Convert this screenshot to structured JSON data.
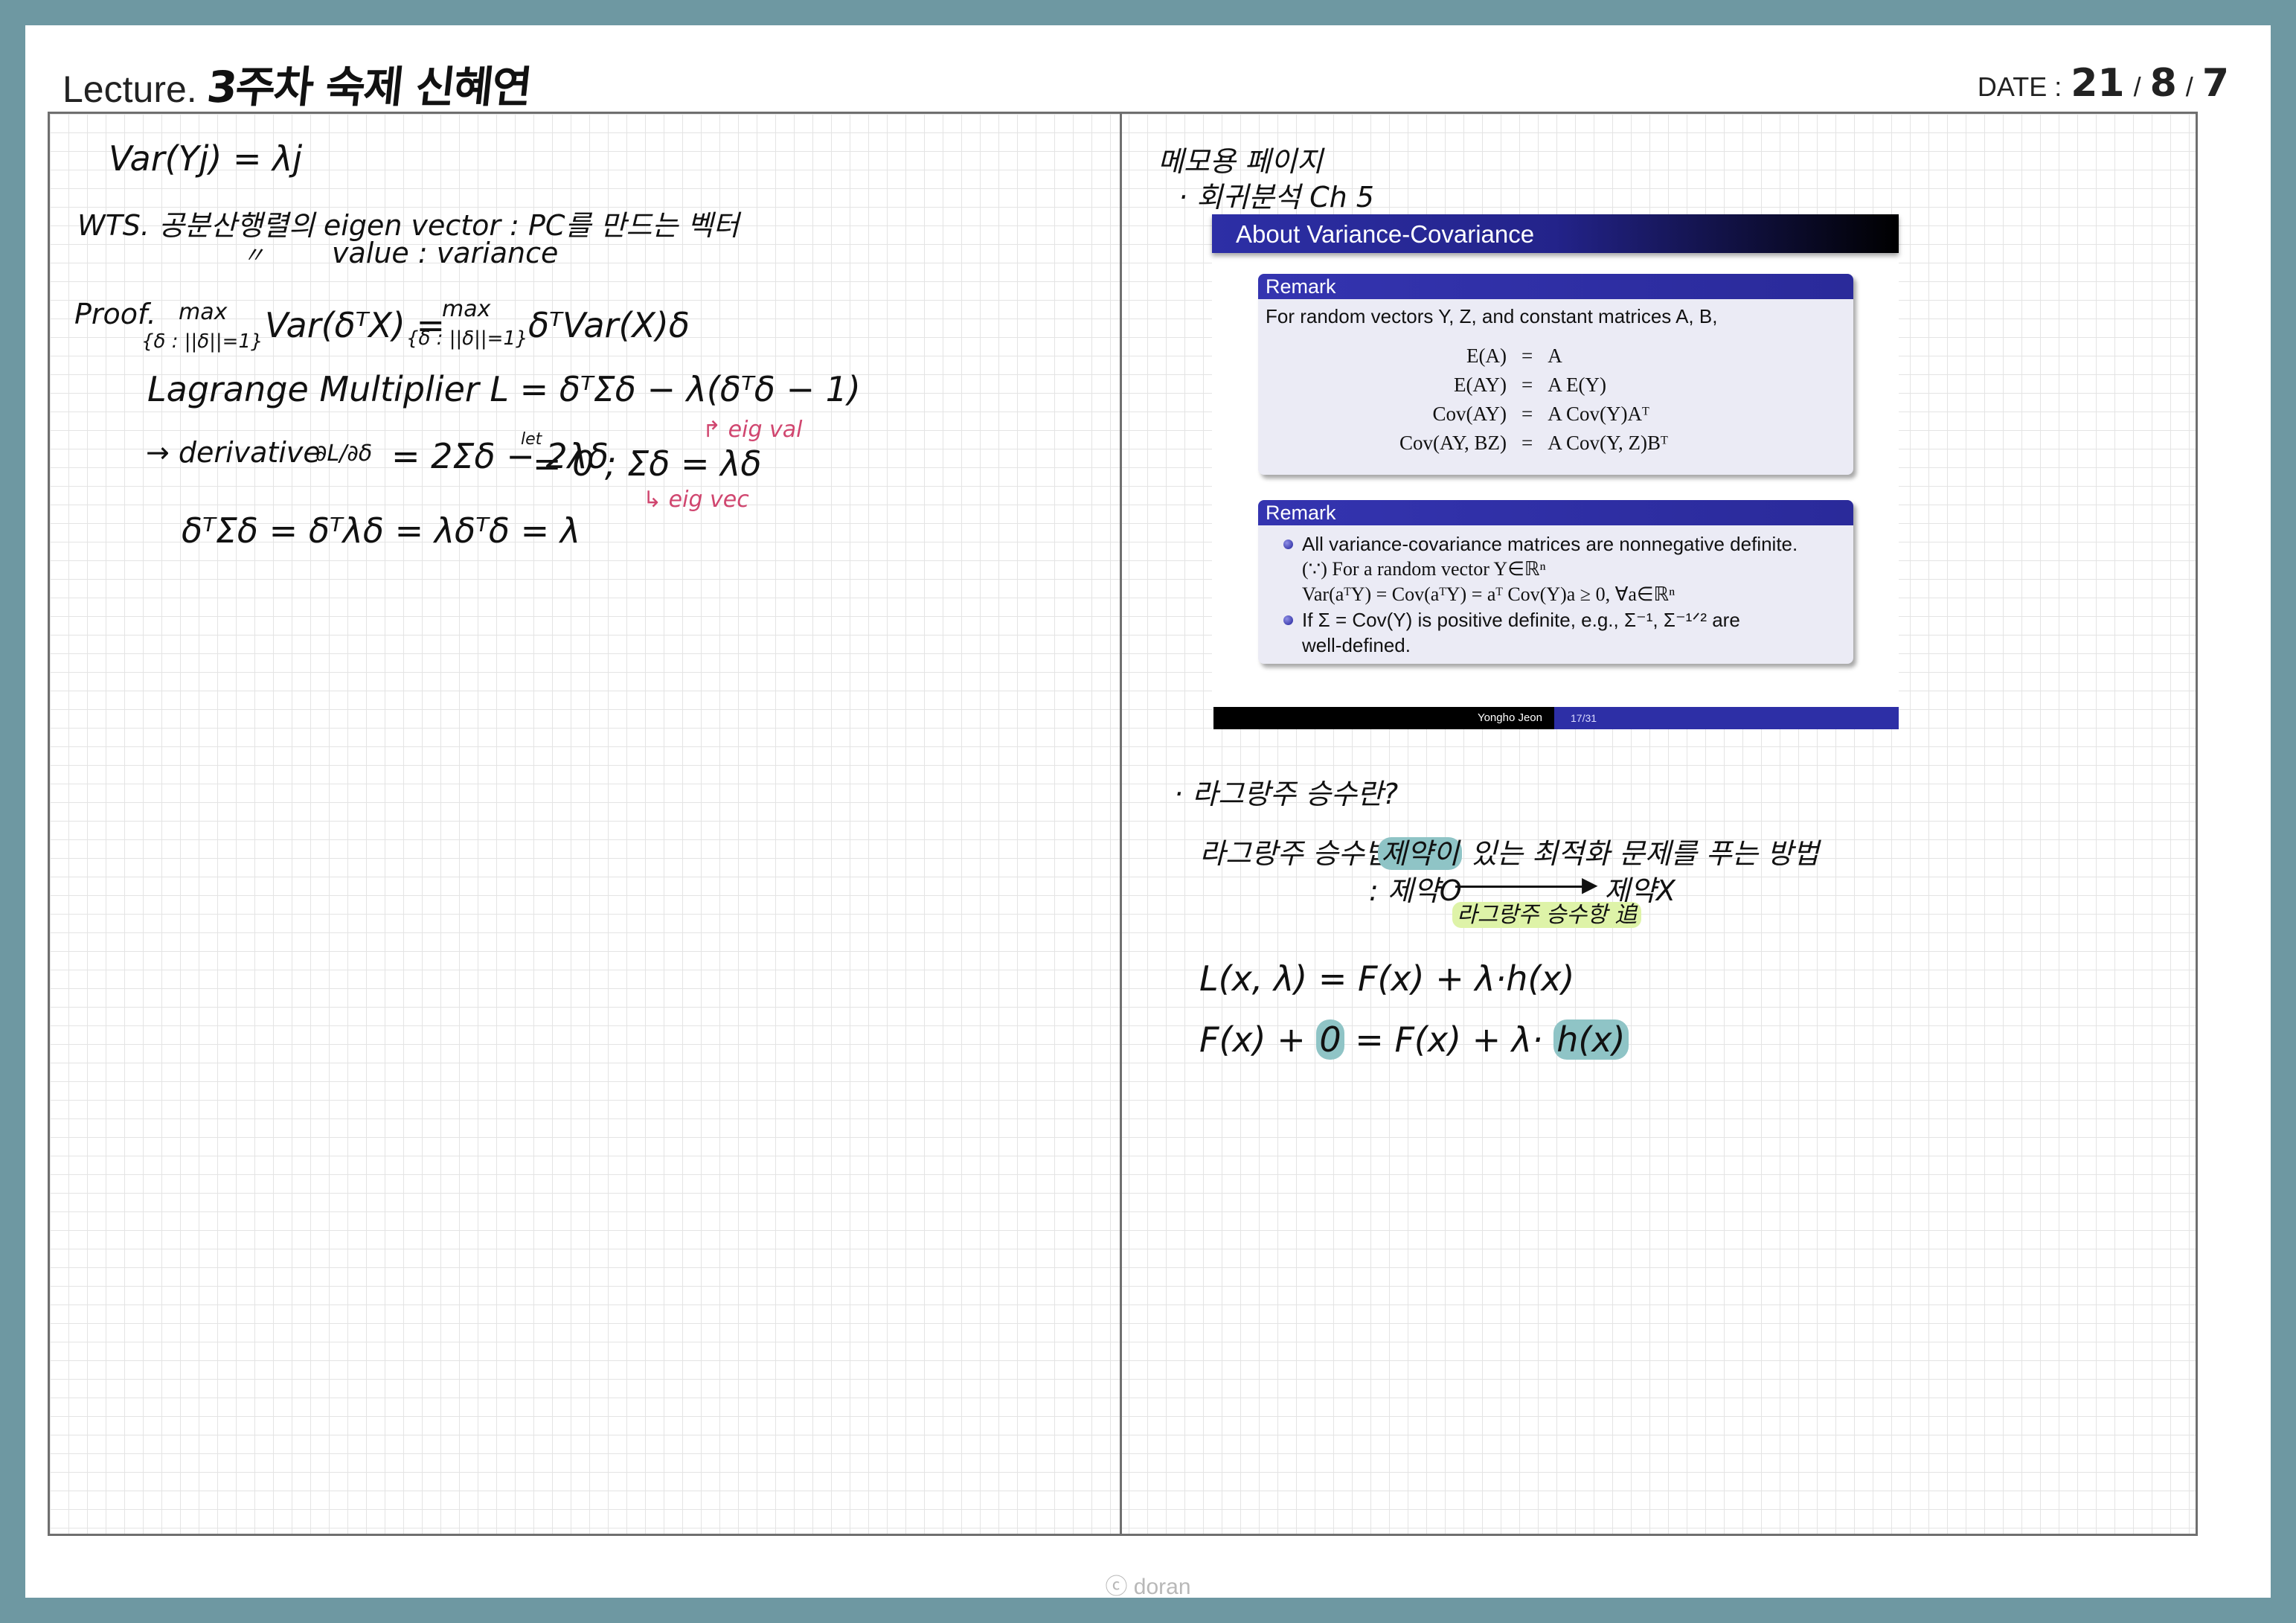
{
  "header": {
    "lecture_label": "Lecture.",
    "lecture_title": "3주차 숙제  신혜연",
    "date_label": "DATE :",
    "date_year": "21",
    "date_month": "8",
    "date_day": "7",
    "date_sep": "/"
  },
  "left_page": {
    "line1": "Var(Yj) = λj",
    "wts_line1": "WTS. 공분산행렬의 eigen vector : PC를 만드는 벡터",
    "wts_ditto": "〃",
    "wts_line2": "value : variance",
    "proof_label": "Proof.",
    "proof_max1": "max",
    "proof_sub1": "{δ : ||δ||=1}",
    "proof_eq1": "Var(δᵀX) =",
    "proof_max2": "max",
    "proof_sub2": "{δ : ||δ||=1}",
    "proof_eq2": "δᵀVar(X)δ",
    "lagrange": "Lagrange Multiplier  L = δᵀΣδ − λ(δᵀδ − 1)",
    "derivative": "→ derivative",
    "deriv_frac": "∂L/∂δ",
    "deriv_eq": "= 2Σδ − 2λδ",
    "set_label": "let",
    "deriv_end": "= 0  ;  Σδ = λδ",
    "eig_val": "↱ eig val",
    "eig_vec": "↳ eig vec",
    "final": "δᵀΣδ = δᵀλδ = λδᵀδ = λ"
  },
  "right_page": {
    "memo_title": "메모용 페이지",
    "bullet1": "· 회귀분석 Ch 5",
    "bullet2": "· 라그랑주 승수란?",
    "method_label": "라그랑주 승수법 :",
    "method_hl": "제약이",
    "method_rest": "있는 최적화 문제를 푸는 방법",
    "constraint_o": ": 제약O",
    "constraint_x": "제약X",
    "constraint_via": "라그랑주 승수항 追",
    "eq_l": "L(x, λ) = F(x) + λ·h(x)",
    "eq_f_a": "F(x) +",
    "eq_f_zero": "0",
    "eq_f_b": "= F(x) + λ·",
    "eq_f_h": "h(x)"
  },
  "slide": {
    "title": "About Variance-Covariance",
    "remark1_head": "Remark",
    "remark1_text": "For random vectors Y, Z, and constant matrices A, B,",
    "equations": [
      {
        "l": "E(A)",
        "op": "=",
        "r": "A"
      },
      {
        "l": "E(AY)",
        "op": "=",
        "r": "A E(Y)"
      },
      {
        "l": "Cov(AY)",
        "op": "=",
        "r": "A Cov(Y)Aᵀ"
      },
      {
        "l": "Cov(AY, BZ)",
        "op": "=",
        "r": "A Cov(Y, Z)Bᵀ"
      }
    ],
    "remark2_head": "Remark",
    "remark2_b1": "All variance-covariance matrices are nonnegative definite.",
    "remark2_b1_l2": "(∵) For a random vector Y∈ℝⁿ",
    "remark2_b1_l3": "Var(aᵀY) = Cov(aᵀY) = aᵀ Cov(Y)a ≥ 0,   ∀a∈ℝⁿ",
    "remark2_b2": "If Σ = Cov(Y) is positive definite, e.g., Σ⁻¹, Σ⁻¹ᐟ² are",
    "remark2_b2_l2": "well-defined.",
    "footer_author": "Yongho Jeon",
    "footer_page": "17/31"
  },
  "copyright": "ⓒ doran"
}
